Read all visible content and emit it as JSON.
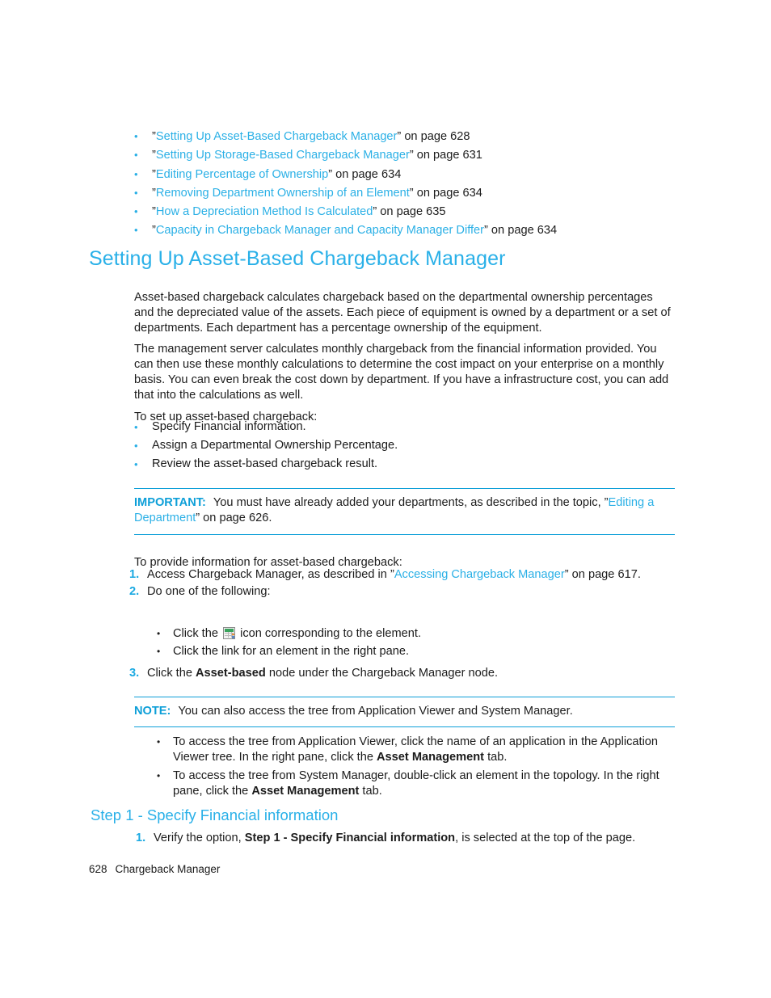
{
  "document": {
    "footer": {
      "page_number": "628",
      "chapter_title": "Chargeback Manager"
    },
    "accent_color": "#29b0e8",
    "link_color": "#2bb0e6",
    "rule_color": "#0d9fd8"
  },
  "xref_list": {
    "items": [
      {
        "quote_open": "”",
        "link": "Setting Up Asset-Based Chargeback Manager",
        "tail": "” on page 628"
      },
      {
        "quote_open": "”",
        "link": "Setting Up Storage-Based Chargeback Manager",
        "tail": "” on page 631"
      },
      {
        "quote_open": "”",
        "link": "Editing Percentage of Ownership",
        "tail": "” on page 634"
      },
      {
        "quote_open": "”",
        "link": "Removing Department Ownership of an Element",
        "tail": "” on page 634"
      },
      {
        "quote_open": "”",
        "link": "How a Depreciation Method Is Calculated",
        "tail": "” on page 635"
      },
      {
        "quote_open": "”",
        "link": "Capacity in Chargeback Manager and Capacity Manager Differ",
        "tail": "” on page 634"
      }
    ],
    "bullet_glyph": "•"
  },
  "heading": {
    "h1": "Setting Up Asset-Based Chargeback Manager",
    "h2_step1": "Step 1 - Specify Financial information"
  },
  "paragraphs": {
    "intro": "Asset-based chargeback calculates chargeback based on the departmental ownership percentages and the depreciated value of the assets. Each piece of equipment is owned by a department or a set of departments. Each department has a percentage ownership of the equipment.",
    "management_server": "The management server calculates monthly chargeback from the financial information provided. You can then use these monthly calculations to determine the cost impact on your enterprise on a monthly basis. You can even break the cost down by department. If you have a infrastructure cost, you can add that into the calculations as well.",
    "to_set_up": "To set up asset-based chargeback:",
    "to_provide": "To provide information for asset-based chargeback:"
  },
  "setup_steps": {
    "bullet_glyph": "•",
    "items": [
      "Specify Financial information.",
      "Assign a Departmental Ownership Percentage.",
      "Review the asset-based chargeback result."
    ]
  },
  "important_note": {
    "label": "IMPORTANT:",
    "text_before_link": "You must have already added your departments, as described in the topic, ”",
    "link": "Editing a Department",
    "text_after_link": "” on page 626."
  },
  "procedure": {
    "step1": {
      "marker": "1.",
      "text_before_link": "Access Chargeback Manager, as described in ”",
      "link": "Accessing Chargeback Manager",
      "text_after_link": "” on page 617."
    },
    "step2": {
      "marker": "2.",
      "text": "Do one of the following:",
      "bullet_glyph": "•",
      "sub_items": {
        "first_before_icon": "Click the",
        "icon_name": "spreadsheet-icon",
        "first_after_icon": "icon corresponding to the element.",
        "second": "Click the link for an element in the right pane."
      }
    },
    "step3": {
      "marker": "3.",
      "text_before_bold": "Click the ",
      "bold": "Asset-based",
      "text_after_bold": " node under the Chargeback Manager node."
    }
  },
  "note_box": {
    "label": "NOTE:",
    "text": "You can also access the tree from Application Viewer and System Manager."
  },
  "note_bullets": {
    "bullet_glyph": "•",
    "items": [
      {
        "before_bold": "To access the tree from Application Viewer, click the name of an application in the Application Viewer tree. In the right pane, click the ",
        "bold": "Asset Management",
        "after_bold": " tab."
      },
      {
        "before_bold": "To access the tree from System Manager, double-click an element in the topology. In the right pane, click the ",
        "bold": "Asset Management",
        "after_bold": " tab."
      }
    ]
  },
  "step1_procedure": {
    "marker": "1.",
    "text_before_bold": "Verify the option, ",
    "bold": "Step 1 - Specify Financial information",
    "text_after_bold": ", is selected at the top of the page."
  }
}
